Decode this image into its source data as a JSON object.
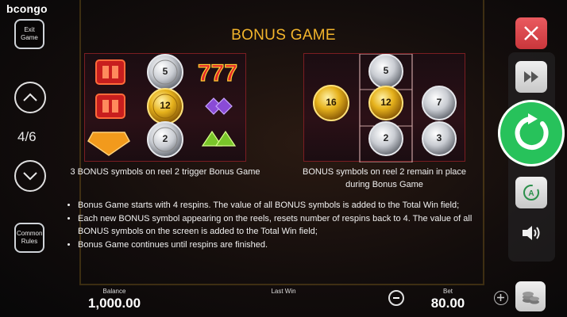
{
  "logo": "bcongo",
  "left": {
    "exit_label": "Exit Game",
    "page_indicator": "4/6",
    "common_rules_label": "Common Rules"
  },
  "title": "BONUS GAME",
  "panel_left": {
    "coins": [
      "5",
      "12",
      "2"
    ],
    "caption": "3 BONUS symbols on reel 2 trigger Bonus Game"
  },
  "panel_right": {
    "coins": [
      "5",
      "16",
      "12",
      "7",
      "2",
      "3"
    ],
    "caption_line1": "BONUS symbols on reel 2 remain in place",
    "caption_line2": "during Bonus Game"
  },
  "rules": [
    "Bonus Game starts with 4 respins. The value of all BONUS symbols is added to the Total Win field;",
    "Each new BONUS symbol appearing on the reels, resets number of respins back to 4. The value of all BONUS symbols on the screen is added to the Total Win field;",
    "Bonus Game continues until respins are finished."
  ],
  "footer": {
    "balance_label": "Balance",
    "balance_value": "1,000.00",
    "last_win_label": "Last Win",
    "bet_label": "Bet",
    "bet_value": "80.00"
  },
  "colors": {
    "accent_gold": "#f3b52c",
    "spin_green": "#27c25b",
    "close_red": "#e0474c"
  }
}
